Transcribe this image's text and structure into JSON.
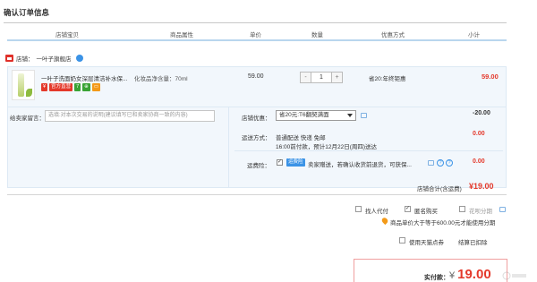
{
  "page": {
    "title": "确认订单信息"
  },
  "columns": [
    "店铺宝贝",
    "商品属性",
    "单价",
    "数量",
    "优惠方式",
    "小计"
  ],
  "shop": {
    "label": "店铺：",
    "name": "一叶子旗舰店"
  },
  "item": {
    "name": "一叶子洗面奶女深层清洁补水保...",
    "spec": "化妆品净含量：70ml",
    "badges": [
      "官方直营",
      "7",
      "⊕"
    ],
    "price": "59.00",
    "quantity": "1",
    "qty_minus": "-",
    "qty_plus": "+",
    "promo": "省20:年终钜惠",
    "subtotal": "59.00"
  },
  "message": {
    "label": "给卖家留言：",
    "placeholder": "选填:对本次交易的说明(建议填写已和卖家协商一致的内容)"
  },
  "shop_discount": {
    "label": "店铺优惠：",
    "selected": "省20元:T6翻契满面",
    "amount": "-20.00"
  },
  "shipping": {
    "label": "运送方式：",
    "line1": "普通配送 快递 免邮",
    "line2": "16:00前付款，预计12月22日(周四)送达",
    "amount": "0.00"
  },
  "insurance": {
    "label": "运费险：",
    "checked": "✓",
    "badge": "运费险",
    "text": "卖家赠送，若确认收货前退货，可获保...",
    "amount": "0.00",
    "q1": "?",
    "q2": "?"
  },
  "shop_total": {
    "label": "店铺合计(含运费)",
    "value": "¥19.00"
  },
  "options": {
    "proxy_pay": "找人代付",
    "anonymous": "匿名购买",
    "anonymous_check": "✓",
    "installment": "花呗分期",
    "installment_note": "商品单价大于等于600.00元才能使用分期",
    "tmall_points": "使用天猫点券",
    "back_to_cart": "结算已扣除"
  },
  "payment": {
    "label": "实付款：",
    "currency": "¥",
    "value": "19.00"
  },
  "colors": {
    "accent_red": "#e4392b",
    "rule_blue": "#b9d6ee",
    "row_bg": "#f2f7fc"
  }
}
